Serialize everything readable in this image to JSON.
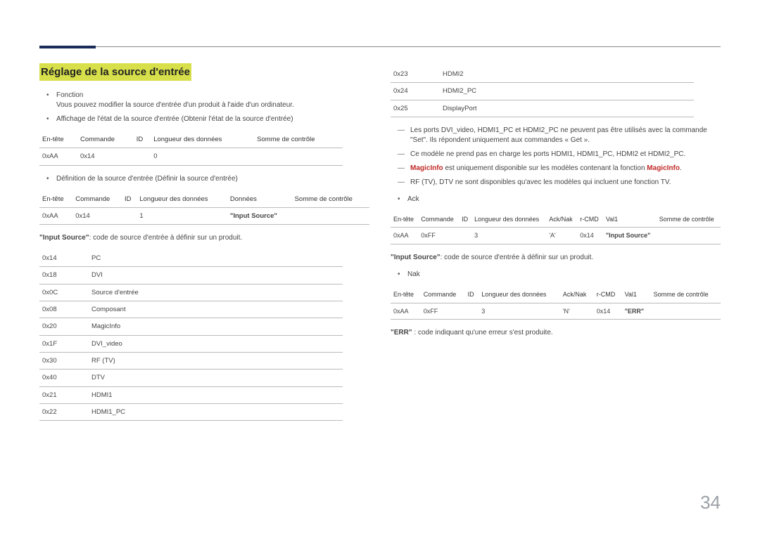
{
  "pageNumber": "34",
  "heading": "Réglage de la source d'entrée",
  "left": {
    "fonctionLabel": "Fonction",
    "fonctionDesc": "Vous pouvez modifier la source d'entrée d'un produit à l'aide d'un ordinateur.",
    "affichage": "Affichage de l'état de la source d'entrée (Obtenir l'état de la source d'entrée)",
    "t1": {
      "h": [
        "En-tête",
        "Commande",
        "ID",
        "Longueur des données",
        "Somme de contrôle"
      ],
      "r": [
        "0xAA",
        "0x14",
        "",
        "0",
        ""
      ]
    },
    "definition": "Définition de la source d'entrée (Définir la source d'entrée)",
    "t2": {
      "h": [
        "En-tête",
        "Commande",
        "ID",
        "Longueur des données",
        "Données",
        "Somme de contrôle"
      ],
      "r": [
        "0xAA",
        "0x14",
        "",
        "1",
        "\"Input Source\"",
        ""
      ]
    },
    "note1a": "\"Input Source\"",
    "note1b": ": code de source d'entrée à définir sur un produit.",
    "sources": [
      [
        "0x14",
        "PC"
      ],
      [
        "0x18",
        "DVI"
      ],
      [
        "0x0C",
        "Source d'entrée"
      ],
      [
        "0x08",
        "Composant"
      ],
      [
        "0x20",
        "MagicInfo"
      ],
      [
        "0x1F",
        "DVI_video"
      ],
      [
        "0x30",
        "RF (TV)"
      ],
      [
        "0x40",
        "DTV"
      ],
      [
        "0x21",
        "HDMI1"
      ],
      [
        "0x22",
        "HDMI1_PC"
      ]
    ]
  },
  "right": {
    "sourcesCont": [
      [
        "0x23",
        "HDMI2"
      ],
      [
        "0x24",
        "HDMI2_PC"
      ],
      [
        "0x25",
        "DisplayPort"
      ]
    ],
    "dash1": "Les ports DVI_video, HDMI1_PC et HDMI2_PC ne peuvent pas être utilisés avec la commande \"Set\". Ils répondent uniquement aux commandes « Get ».",
    "dash2": "Ce modèle ne prend pas en charge les ports HDMI1, HDMI1_PC, HDMI2 et HDMI2_PC.",
    "dash3a": "MagicInfo",
    "dash3b": " est uniquement disponible sur les modèles contenant la fonction ",
    "dash3c": "MagicInfo",
    "dash3d": ".",
    "dash4": "RF (TV), DTV ne sont disponibles qu'avec les modèles qui incluent une fonction TV.",
    "ack": "Ack",
    "t3": {
      "h": [
        "En-tête",
        "Commande",
        "ID",
        "Longueur des données",
        "Ack/Nak",
        "r-CMD",
        "Val1",
        "Somme de contrôle"
      ],
      "r": [
        "0xAA",
        "0xFF",
        "",
        "3",
        "'A'",
        "0x14",
        "\"Input Source\"",
        ""
      ]
    },
    "note2a": "\"Input Source\"",
    "note2b": ": code de source d'entrée à définir sur un produit.",
    "nak": "Nak",
    "t4": {
      "h": [
        "En-tête",
        "Commande",
        "ID",
        "Longueur des données",
        "Ack/Nak",
        "r-CMD",
        "Val1",
        "Somme de contrôle"
      ],
      "r": [
        "0xAA",
        "0xFF",
        "",
        "3",
        "'N'",
        "0x14",
        "\"ERR\"",
        ""
      ]
    },
    "errA": "\"ERR\"",
    "errB": " : code indiquant qu'une erreur s'est produite."
  }
}
